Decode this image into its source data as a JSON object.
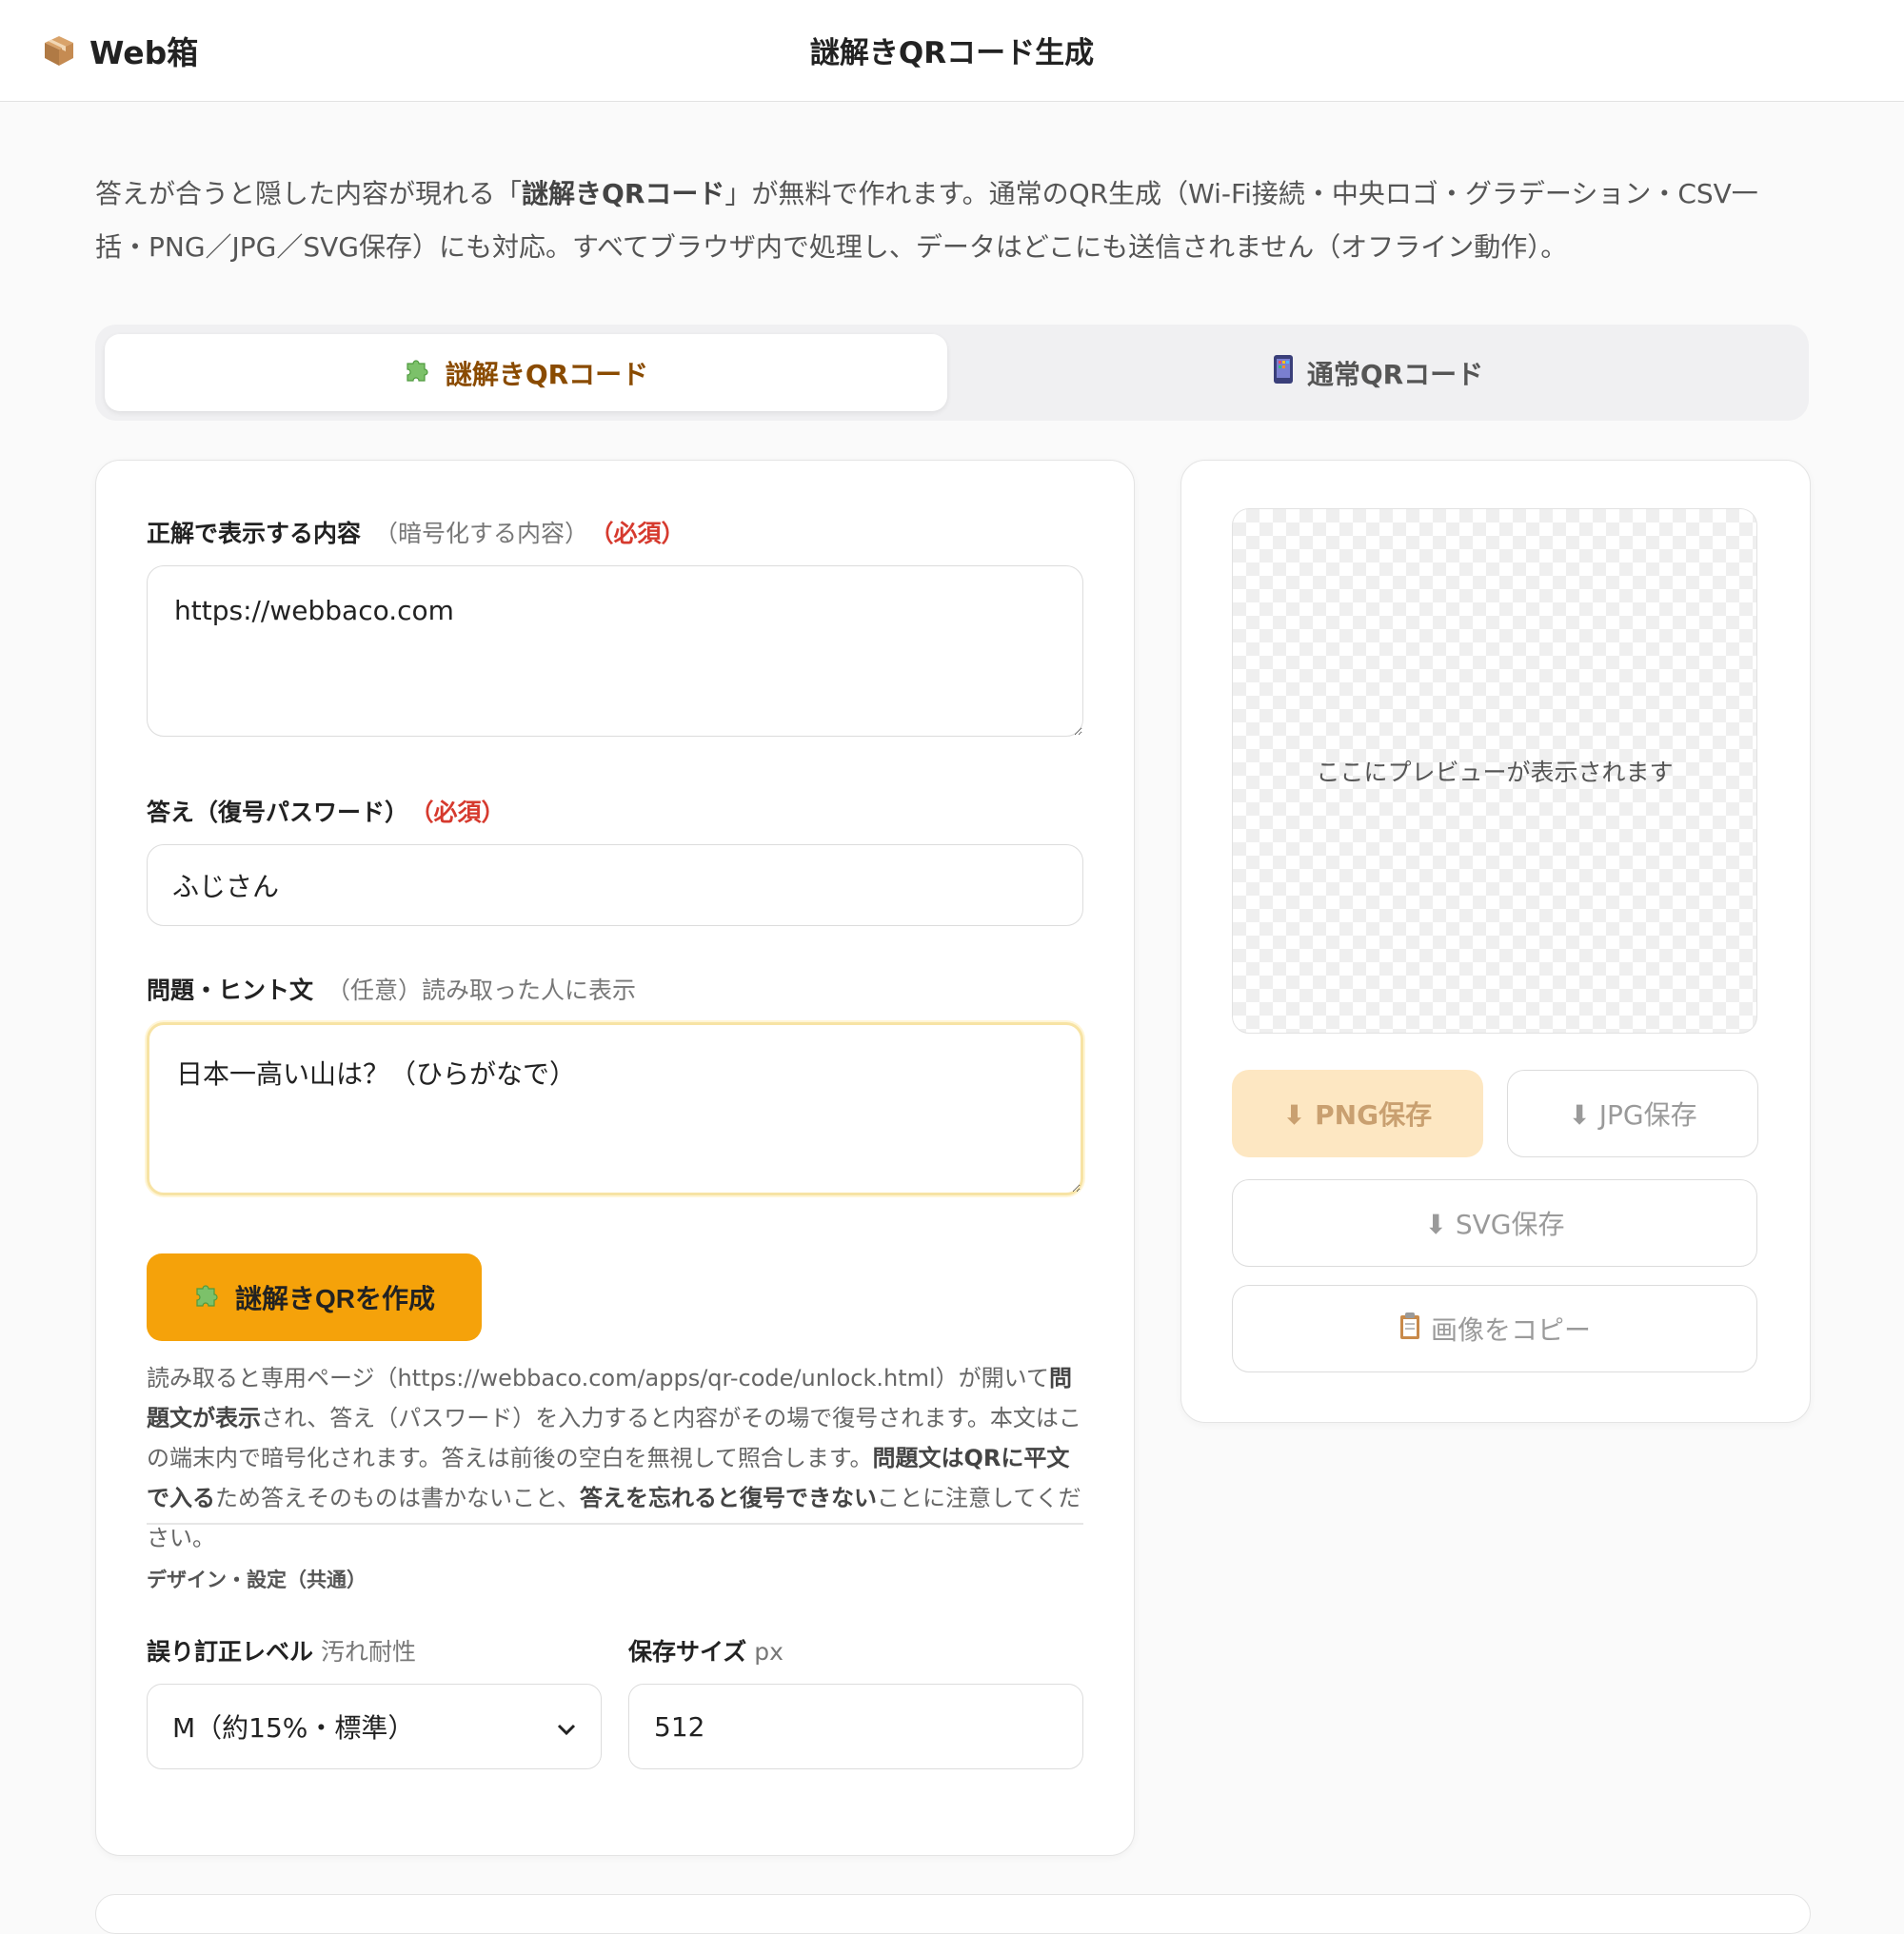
{
  "header": {
    "brand": "Web箱",
    "brand_icon": "package-box-icon",
    "title": "謎解きQRコード生成"
  },
  "intro": {
    "part1": "答えが合うと隠した内容が現れる「",
    "bold": "謎解きQRコード",
    "part2": "」が無料で作れます。通常のQR生成（Wi-Fi接続・中央ロゴ・グラデーション・CSV一括・PNG／JPG／SVG保存）にも対応。すべてブラウザ内で処理し、データはどこにも送信されません（オフライン動作）。"
  },
  "tabs": [
    {
      "label": "謎解きQRコード",
      "icon": "puzzle-piece-icon",
      "active": true
    },
    {
      "label": "通常QRコード",
      "icon": "mobile-phone-icon",
      "active": false
    }
  ],
  "form": {
    "content": {
      "label": "正解で表示する内容",
      "sub": "（暗号化する内容）",
      "required": "（必須）",
      "value": "https://webbaco.com"
    },
    "answer": {
      "label": "答え（復号パスワード）",
      "required": "（必須）",
      "value": "ふじさん"
    },
    "hint": {
      "label": "問題・ヒント文",
      "sub": "（任意）読み取った人に表示",
      "value": "日本一高い山は？（ひらがなで）"
    },
    "create_button": "謎解きQRを作成",
    "note": {
      "t1": "読み取ると専用ページ（https://webbaco.com/apps/qr-code/unlock.html）が開いて",
      "b1": "問題文が表示",
      "t2": "され、答え（パスワード）を入力すると内容がその場で復号されます。本文はこの端末内で暗号化されます。答えは前後の空白を無視して照合します。",
      "b2": "問題文はQRに平文で入る",
      "t3": "ため答えそのものは書かないこと、",
      "b3": "答えを忘れると復号できない",
      "t4": "ことに注意してください。"
    },
    "design_section": "デザイン・設定（共通）",
    "ecc": {
      "label": "誤り訂正レベル",
      "sub": "汚れ耐性",
      "selected": "M（約15%・標準）"
    },
    "size": {
      "label": "保存サイズ",
      "sub": "px",
      "value": "512"
    }
  },
  "preview": {
    "placeholder": "ここにプレビューが表示されます",
    "png": "⬇ PNG保存",
    "jpg": "⬇ JPG保存",
    "svg": "⬇ SVG保存",
    "copy": "画像をコピー"
  },
  "colors": {
    "accent": "#f5a20a",
    "required": "#d63a2e",
    "active_tab_text": "#8a4b00"
  }
}
